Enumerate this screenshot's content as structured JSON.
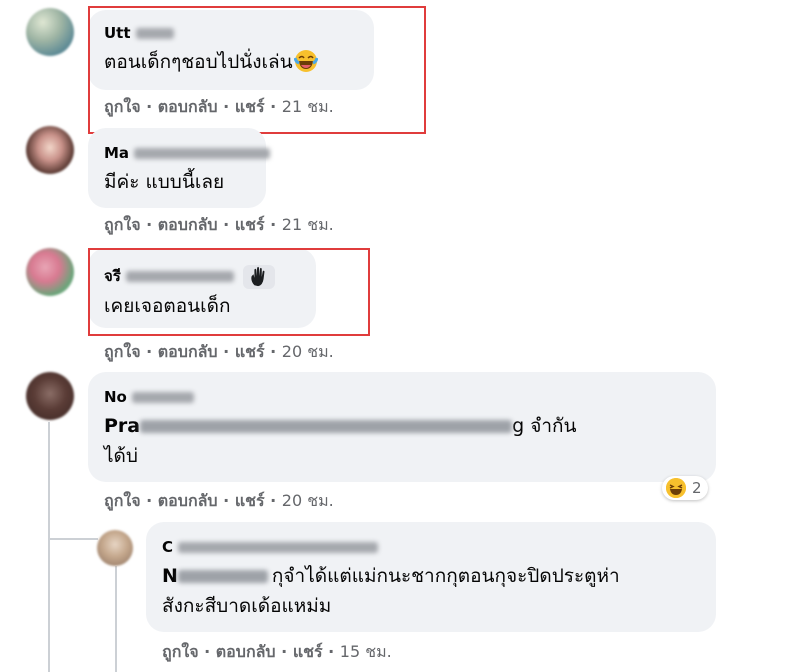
{
  "comments": [
    {
      "name_prefix": "Utt",
      "text": "ตอนเด็กๆชอบไปนั่งเล่น",
      "emoji": "laughing-crying-emoji",
      "actions": {
        "like": "ถูกใจ",
        "reply": "ตอบกลับ",
        "share": "แชร์",
        "time": "21 ชม."
      }
    },
    {
      "name_prefix": "Ma",
      "text": "มีค่ะ แบบนี้เลย",
      "actions": {
        "like": "ถูกใจ",
        "reply": "ตอบกลับ",
        "share": "แชร์",
        "time": "21 ชม."
      }
    },
    {
      "name_prefix": "จรี",
      "badge_icon": "waving-hand-icon",
      "text": "เคยเจอตอนเด็ก",
      "actions": {
        "like": "ถูกใจ",
        "reply": "ตอบกลับ",
        "share": "แชร์",
        "time": "20 ชม."
      }
    },
    {
      "name_prefix": "No",
      "text_prefix": "Pra",
      "text_suffix": "g จำกัน",
      "text_line2": "ได้บ่",
      "reaction": {
        "icon": "haha-reaction-icon",
        "count": "2"
      },
      "actions": {
        "like": "ถูกใจ",
        "reply": "ตอบกลับ",
        "share": "แชร์",
        "time": "20 ชม."
      }
    },
    {
      "name_prefix": "C",
      "text_prefix": "N",
      "text_line1": "กุจำได้แต่แม่กนะชากกุตอนกุจะปิดประตูห่า",
      "text_line2": "สังกะสีบาดเด้อแหม่ม",
      "actions": {
        "like": "ถูกใจ",
        "reply": "ตอบกลับ",
        "share": "แชร์",
        "time": "15 ชม."
      }
    }
  ],
  "colors": {
    "bubble": "#f0f2f5",
    "highlight_box": "#e03c3c",
    "meta_text": "#65676b"
  }
}
